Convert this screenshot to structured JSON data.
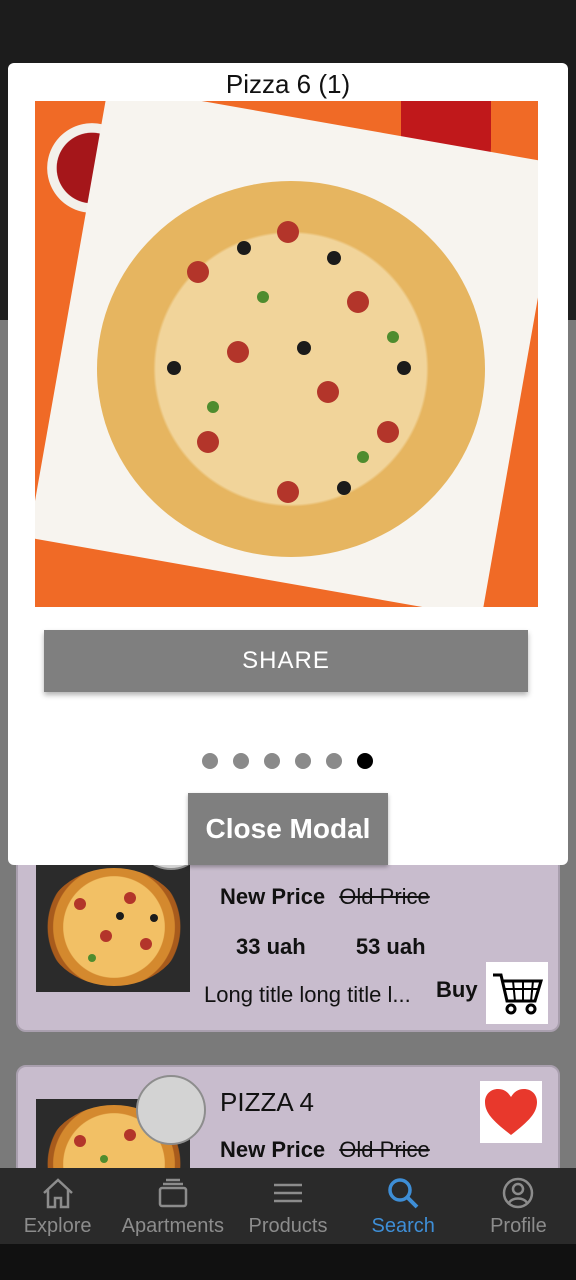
{
  "modal": {
    "title": "Pizza 6 (1)",
    "share_label": "SHARE",
    "close_label": "Close Modal",
    "carousel": {
      "total": 6,
      "active_index": 5
    }
  },
  "cards": [
    {
      "title": "",
      "new_price_label": "New Price",
      "old_price_label": "Old Price",
      "new_price": "33 uah",
      "old_price": "53 uah",
      "description": "Long title long title l...",
      "buy_label": "Buy",
      "icons": [
        "heart-icon",
        "cart-icon"
      ]
    },
    {
      "title": "PIZZA 4",
      "new_price_label": "New Price",
      "old_price_label": "Old Price",
      "icons": [
        "heart-icon"
      ]
    }
  ],
  "nav": {
    "items": [
      {
        "label": "Explore",
        "icon": "home-icon"
      },
      {
        "label": "Apartments",
        "icon": "apartments-icon"
      },
      {
        "label": "Products",
        "icon": "menu-icon"
      },
      {
        "label": "Search",
        "icon": "search-icon",
        "active": true
      },
      {
        "label": "Profile",
        "icon": "profile-icon"
      }
    ]
  },
  "colors": {
    "accent": "#3e8ed6",
    "card_bg": "#c8bccd",
    "heart": "#e8382c",
    "button_gray": "#7f7f7f"
  }
}
